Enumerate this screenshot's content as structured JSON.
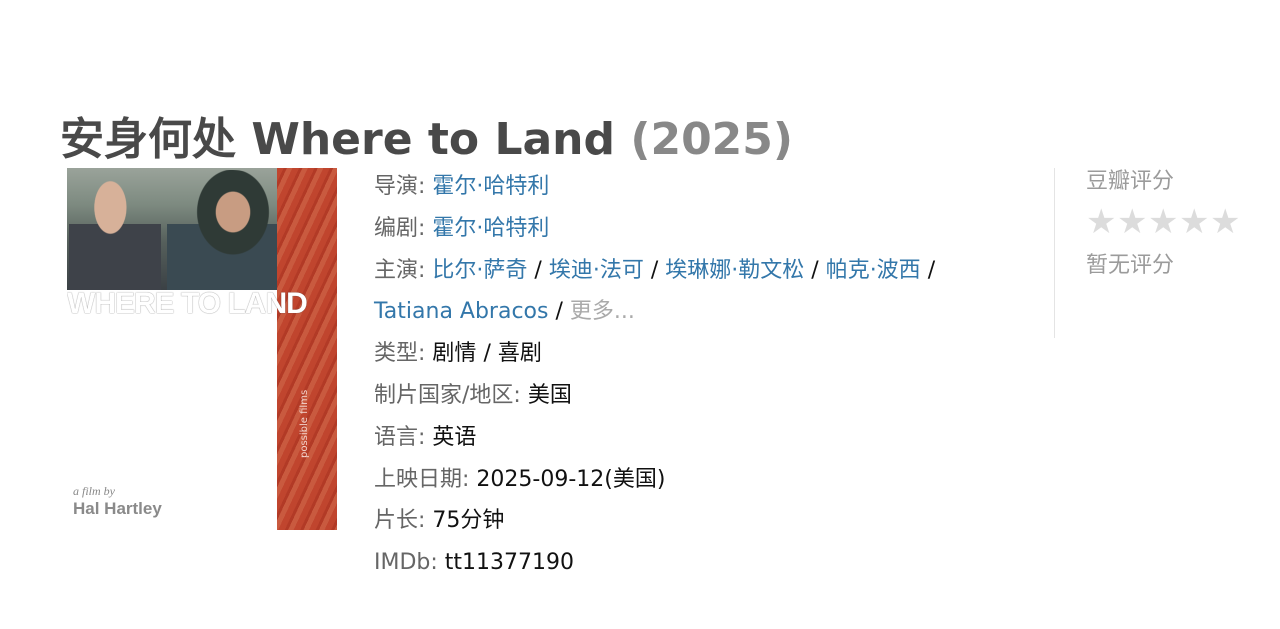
{
  "movie": {
    "title": "安身何处 Where to Land",
    "year": "(2025)"
  },
  "poster": {
    "title_text": "WHERE TO LAND",
    "byline_small": "a film by",
    "byline_name": "Hal Hartley",
    "studio": "possible films"
  },
  "info": {
    "director_label": "导演:",
    "director": "霍尔·哈特利",
    "writer_label": "编剧:",
    "writer": "霍尔·哈特利",
    "cast_label": "主演:",
    "cast": [
      "比尔·萨奇",
      "埃迪·法可",
      "埃琳娜·勒文松",
      "帕克·波西",
      "Tatiana Abracos"
    ],
    "separator": "/",
    "more": "更多...",
    "genre_label": "类型:",
    "genres": [
      "剧情",
      "喜剧"
    ],
    "country_label": "制片国家/地区:",
    "country": "美国",
    "language_label": "语言:",
    "language": "英语",
    "release_label": "上映日期:",
    "release": "2025-09-12(美国)",
    "runtime_label": "片长:",
    "runtime": "75分钟",
    "imdb_label": "IMDb:",
    "imdb": "tt11377190"
  },
  "rating": {
    "title": "豆瓣评分",
    "stars": "★★★★★",
    "stars_filled": 0,
    "stars_total": 5,
    "no_rating": "暂无评分"
  },
  "colors": {
    "link": "#3377aa",
    "label": "#666666",
    "title": "#494949",
    "year": "#888888",
    "star_empty": "#dcdcdc"
  }
}
